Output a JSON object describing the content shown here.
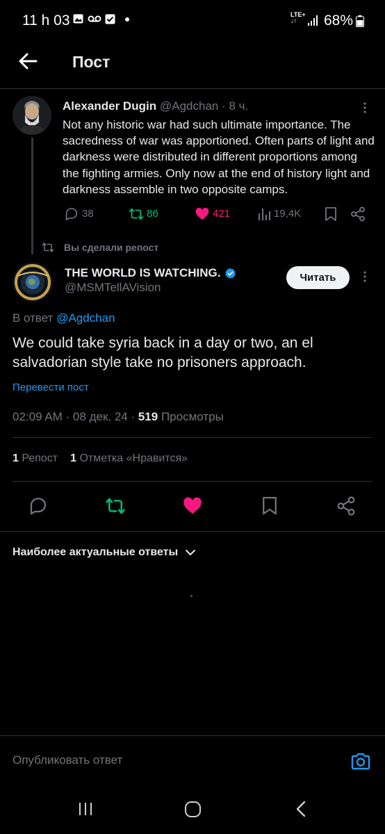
{
  "status_bar": {
    "time": "11 h 03",
    "network": "LTE+",
    "battery": "68%"
  },
  "header": {
    "title": "Пост"
  },
  "parent_tweet": {
    "author_name": "Alexander Dugin",
    "handle_and_time": "@Agdchan · 8 ч.",
    "text": "Not any historic war had such ultimate importance. The sacredness of war was apportioned. Often parts of light and darkness were distributed in different proportions among the fighting armies. Only now at the end of history light and darkness assemble in two opposite camps.",
    "replies": "38",
    "reposts": "86",
    "likes": "421",
    "views": "19,4K",
    "reposted_color": "#00ba7c",
    "liked_color": "#f91880"
  },
  "repost_label": "Вы сделали репост",
  "main_tweet": {
    "author_name": "THE WORLD IS WATCHING.",
    "handle": "@MSMTellAVision",
    "follow_label": "Читать",
    "reply_to_prefix": "В ответ",
    "reply_to_handle": "@Agdchan",
    "text": "We could take syria back in a day or two, an el salvadorian style take no prisoners approach.",
    "translate_label": "Перевести пост",
    "meta_time_date": "02:09 AM · 08 дек. 24 · ",
    "meta_views_count": "519",
    "meta_views_label": " Просмотры",
    "reposts_count": "1",
    "reposts_label": " Репост",
    "likes_count": "1",
    "likes_label": " Отметка «Нравится»",
    "verified_color": "#1d9bf0"
  },
  "action_bar": {
    "icons": [
      "reply-icon",
      "repost-icon",
      "like-icon",
      "bookmark-icon",
      "share-icon"
    ]
  },
  "replies_sort": {
    "label": "Наиболее актуальные ответы"
  },
  "composer": {
    "placeholder": "Опубликовать ответ"
  },
  "nav_bar": {
    "icons": [
      "recents-icon",
      "home-icon",
      "back-icon"
    ]
  }
}
